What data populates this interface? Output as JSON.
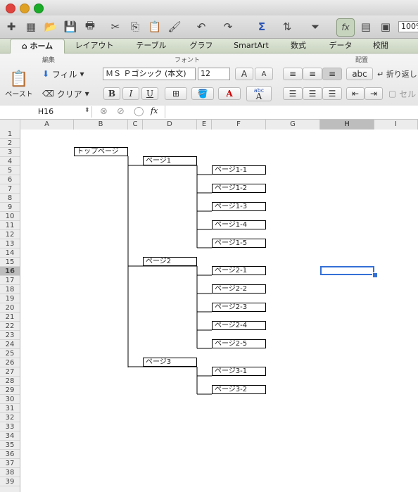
{
  "toolbar": {
    "zoom": "100%"
  },
  "tabs": [
    "ホーム",
    "レイアウト",
    "テーブル",
    "グラフ",
    "SmartArt",
    "数式",
    "データ",
    "校閲"
  ],
  "ribbon": {
    "edit_group": "編集",
    "font_group": "フォント",
    "align_group": "配置",
    "paste_label": "ペースト",
    "fill_label": "フィル",
    "clear_label": "クリア",
    "font_name": "ＭＳ Ｐゴシック (本文)",
    "font_size": "12",
    "bold": "B",
    "italic": "I",
    "underline": "U",
    "wrap_label": "折り返し",
    "merge_label": "セル",
    "abc_label": "abc",
    "grow_font": "A",
    "shrink_font": "A"
  },
  "formula_bar": {
    "name_box": "H16",
    "fx": "fx",
    "value": ""
  },
  "columns": [
    "A",
    "B",
    "C",
    "D",
    "E",
    "F",
    "G",
    "H",
    "I"
  ],
  "selected_column": "H",
  "rows": [
    "1",
    "2",
    "3",
    "4",
    "5",
    "6",
    "7",
    "8",
    "9",
    "10",
    "11",
    "12",
    "13",
    "14",
    "15",
    "16",
    "17",
    "18",
    "19",
    "20",
    "21",
    "22",
    "23",
    "24",
    "25",
    "26",
    "27",
    "28",
    "29",
    "30",
    "31",
    "32",
    "33",
    "34",
    "35",
    "36",
    "37",
    "38",
    "39"
  ],
  "selected_row": "16",
  "tree": {
    "root": "トップページ",
    "pages": [
      {
        "label": "ページ1",
        "children": [
          "ページ1-1",
          "ページ1-2",
          "ページ1-3",
          "ページ1-4",
          "ページ1-5"
        ]
      },
      {
        "label": "ページ2",
        "children": [
          "ページ2-1",
          "ページ2-2",
          "ページ2-3",
          "ページ2-4",
          "ページ2-5"
        ]
      },
      {
        "label": "ページ3",
        "children": [
          "ページ3-1",
          "ページ3-2"
        ]
      }
    ]
  },
  "colors": {
    "selection": "#3470d6",
    "tab_bar": "#c9d4c0"
  }
}
